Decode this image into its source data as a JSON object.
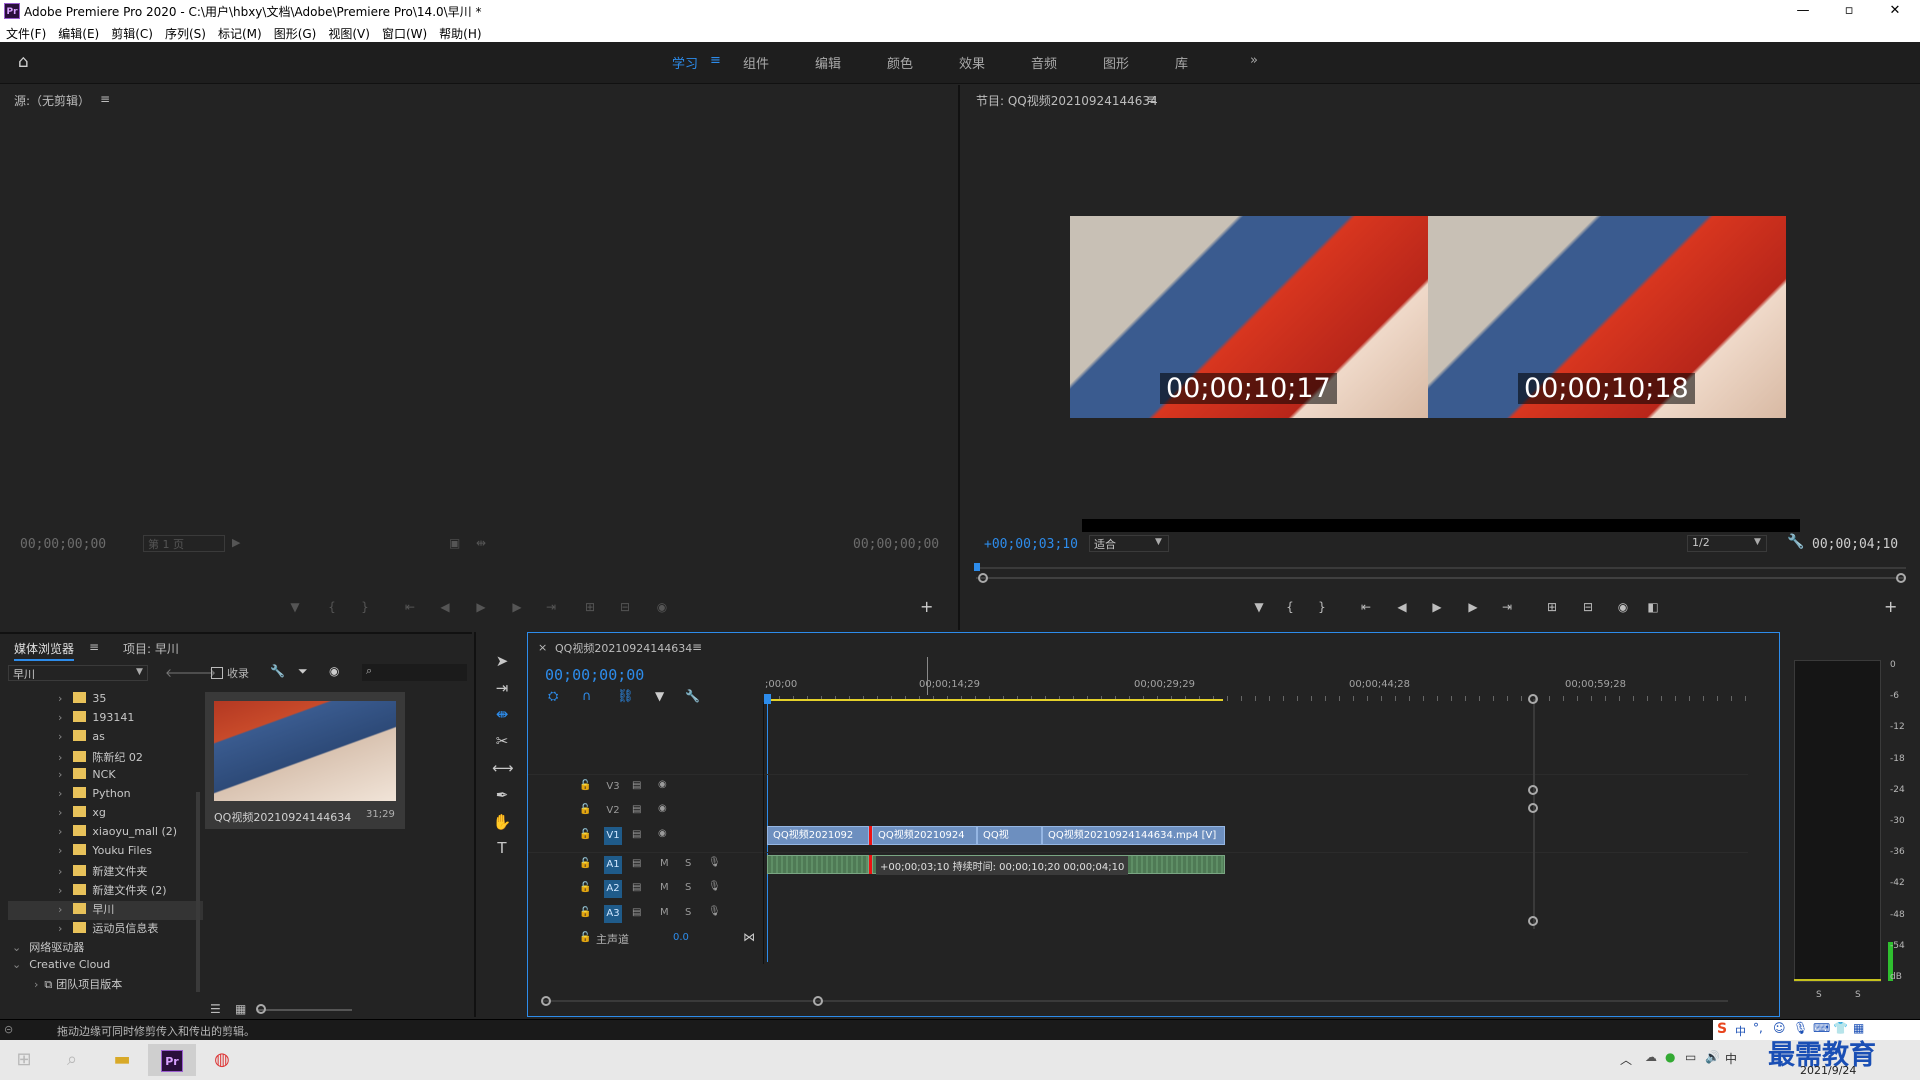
{
  "window": {
    "title": "Adobe Premiere Pro 2020 - C:\\用户\\hbxy\\文档\\Adobe\\Premiere Pro\\14.0\\早川 *",
    "app_icon": "Pr"
  },
  "menu": [
    "文件(F)",
    "编辑(E)",
    "剪辑(C)",
    "序列(S)",
    "标记(M)",
    "图形(G)",
    "视图(V)",
    "窗口(W)",
    "帮助(H)"
  ],
  "workspaces": {
    "active": "学习",
    "tabs": [
      "组件",
      "编辑",
      "颜色",
      "效果",
      "音频",
      "图形",
      "库"
    ],
    "overflow": "»"
  },
  "source": {
    "title": "源:（无剪辑）",
    "tc_left": "00;00;00;00",
    "page": "第 1 页",
    "tc_right": "00;00;00;00"
  },
  "program": {
    "title": "节目: QQ视频20210924144634",
    "frame_left_tc": "00;00;10;17",
    "frame_right_tc": "00;00;10;18",
    "trim_offset": "+00;00;03;10",
    "zoom": "适合",
    "resolution": "1/2",
    "duration": "00;00;04;10"
  },
  "project": {
    "tabs": [
      "媒体浏览器",
      "项目: 早川"
    ],
    "location": "早川",
    "ingest_label": "收录",
    "tree": [
      "35",
      "193141",
      "as",
      "陈新纪 02",
      "NCK",
      "Python",
      "xg",
      "xiaoyu_mall (2)",
      "Youku Files",
      "新建文件夹",
      "新建文件夹 (2)",
      "早川",
      "运动员信息表"
    ],
    "network": "网络驱动器",
    "cloud": "Creative Cloud",
    "team": "团队项目版本",
    "thumb_name": "QQ视频20210924144634",
    "thumb_dur": "31;29"
  },
  "timeline": {
    "title": "QQ视频20210924144634",
    "playhead_tc": "00;00;00;00",
    "ruler": [
      ";00;00",
      "00;00;14;29",
      "00;00;29;29",
      "00;00;44;28",
      "00;00;59;28"
    ],
    "tracks_v": [
      "V3",
      "V2",
      "V1"
    ],
    "tracks_a": [
      "A1",
      "A2",
      "A3"
    ],
    "master": "主声道",
    "master_val": "0.0",
    "clips": [
      "QQ视频2021092",
      "QQ视频20210924",
      "QQ视",
      "QQ视频20210924144634.mp4 [V]"
    ],
    "trim_info": "+00;00;03;10 持续时间: 00;00;10;20 00;00;04;10"
  },
  "meter": {
    "scale": [
      "0",
      "-6",
      "-12",
      "-18",
      "-24",
      "-30",
      "-36",
      "-42",
      "-48",
      "-54",
      "dB"
    ],
    "solo": [
      "S",
      "S"
    ],
    "level": 0.12
  },
  "status": "拖动边缘可同时修剪传入和传出的剪辑。",
  "ime": {
    "brand": "最需教育",
    "lang": "中"
  },
  "taskbar": {
    "date": "2021/9/24"
  },
  "colors": {
    "accent": "#2d8ceb",
    "clip_video": "#6d8fbf",
    "clip_audio": "#4f7a55",
    "folder": "#e8c25a"
  }
}
